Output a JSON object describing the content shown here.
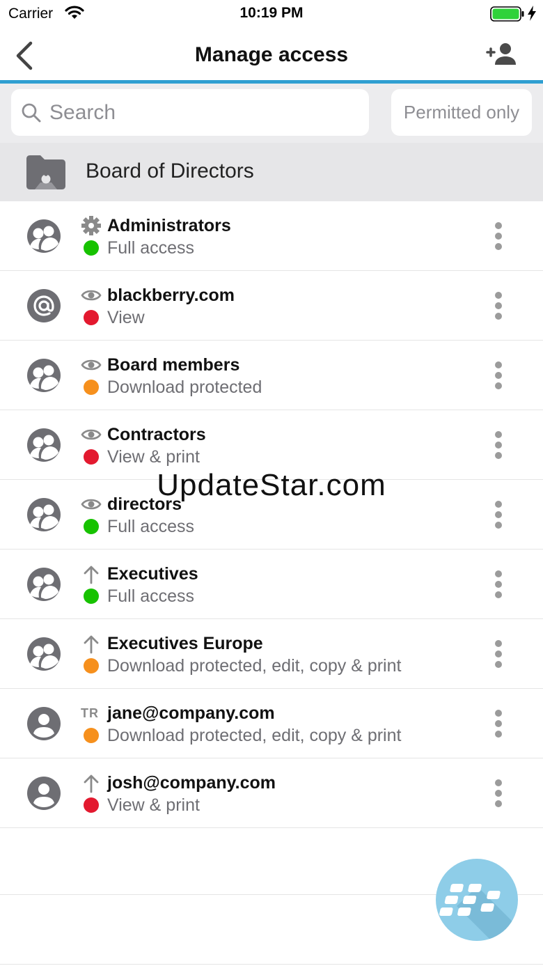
{
  "status_bar": {
    "carrier": "Carrier",
    "time": "10:19 PM"
  },
  "nav": {
    "title": "Manage access"
  },
  "search": {
    "placeholder": "Search",
    "filter_label": "Permitted only"
  },
  "folder": {
    "name": "Board of Directors"
  },
  "colors": {
    "accent": "#2f9fd1",
    "full": "#17c200",
    "restricted": "#f6901d",
    "view": "#e3192f"
  },
  "items": [
    {
      "name": "Administrators",
      "access": "Full access",
      "type_icon": "gear-icon",
      "avatar": "group-icon",
      "dot": "#17c200"
    },
    {
      "name": "blackberry.com",
      "access": "View",
      "type_icon": "eye-icon",
      "avatar": "at-icon",
      "dot": "#e3192f"
    },
    {
      "name": "Board members",
      "access": "Download protected",
      "type_icon": "eye-icon",
      "avatar": "group-icon",
      "dot": "#f6901d"
    },
    {
      "name": "Contractors",
      "access": "View & print",
      "type_icon": "eye-icon",
      "avatar": "group-icon",
      "dot": "#e3192f"
    },
    {
      "name": "directors",
      "access": "Full access",
      "type_icon": "eye-icon",
      "avatar": "group-icon",
      "dot": "#17c200"
    },
    {
      "name": "Executives",
      "access": "Full access",
      "type_icon": "arrow-up-icon",
      "avatar": "group-icon",
      "dot": "#17c200"
    },
    {
      "name": "Executives Europe",
      "access": "Download protected, edit, copy & print",
      "type_icon": "arrow-up-icon",
      "avatar": "group-icon",
      "dot": "#f6901d"
    },
    {
      "name": "jane@company.com",
      "access": "Download protected, edit, copy & print",
      "type_icon": "tr-badge",
      "type_text": "TR",
      "avatar": "person-icon",
      "dot": "#f6901d"
    },
    {
      "name": "josh@company.com",
      "access": "View & print",
      "type_icon": "arrow-up-icon",
      "avatar": "person-icon",
      "dot": "#e3192f"
    }
  ],
  "watermark": "UpdateStar.com"
}
